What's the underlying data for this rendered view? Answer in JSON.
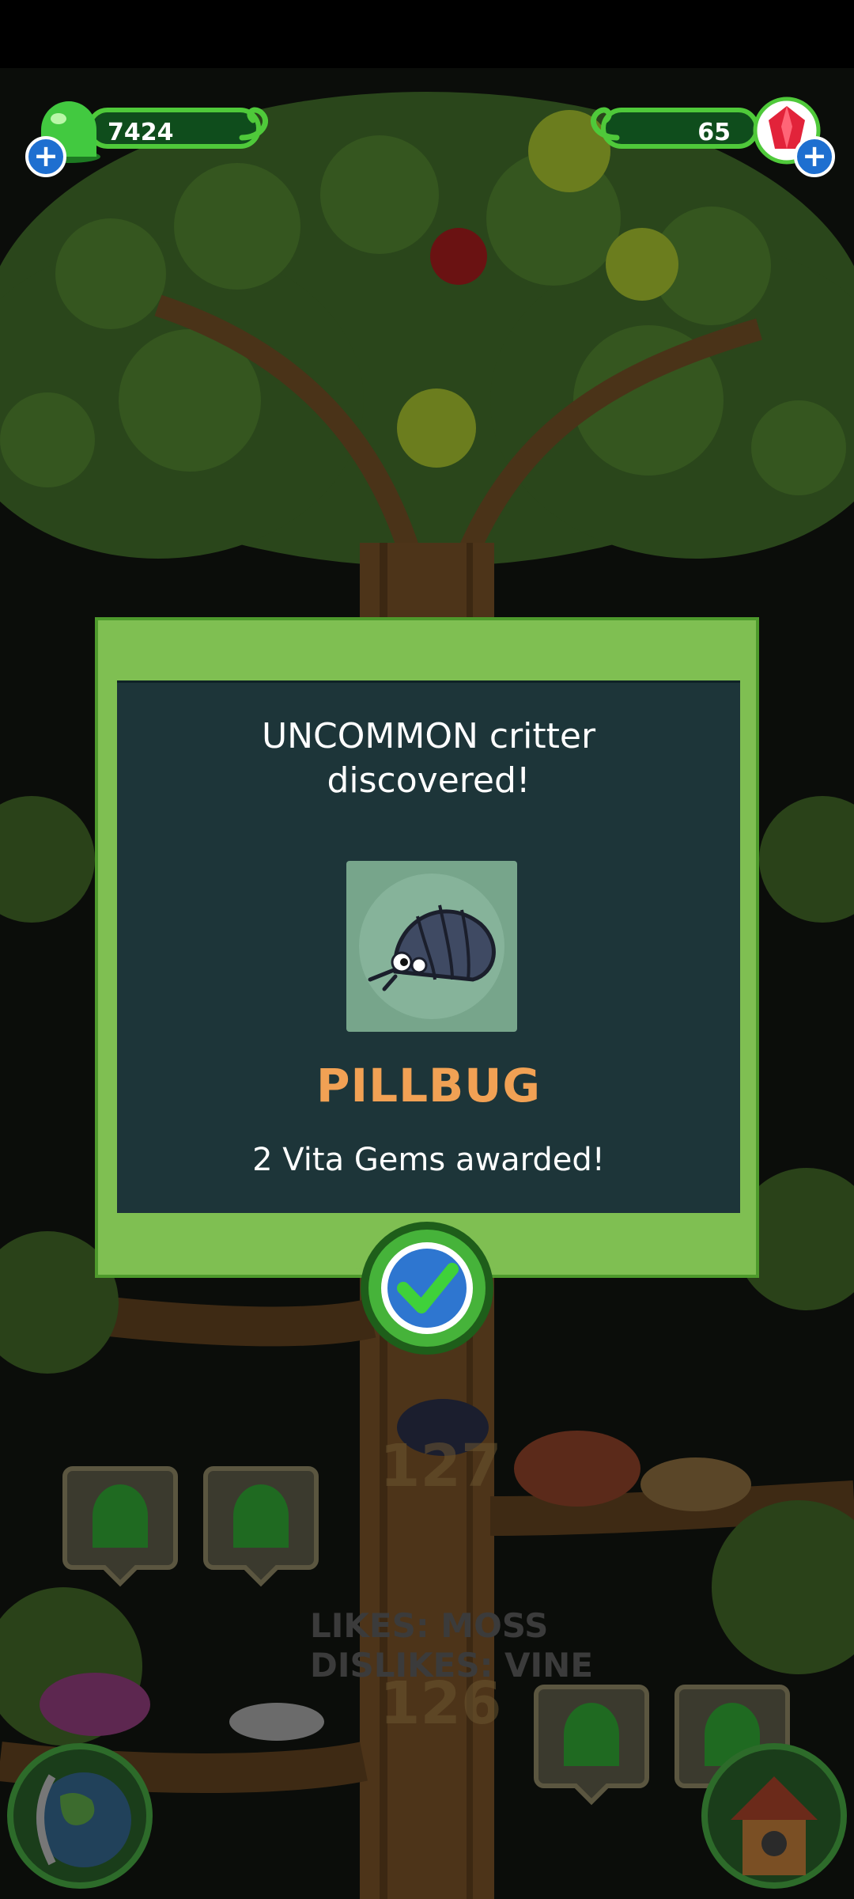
{
  "hud": {
    "gumdrops": "7424",
    "vita_gems": "65"
  },
  "modal": {
    "title_line1": "UNCOMMON critter",
    "title_line2": "discovered!",
    "critter_name": "PILLBUG",
    "award_text": "2 Vita Gems awarded!"
  },
  "tree": {
    "level_upper": "127",
    "level_lower": "126",
    "likes": "LIKES: MOSS",
    "dislikes": "DISLIKES: VINE"
  },
  "icons": {
    "gumdrop": "green-gumdrop-icon",
    "gem": "red-gem-icon",
    "plus": "plus-icon",
    "confirm": "checkmark-icon",
    "globe": "globe-icon",
    "house": "house-icon"
  },
  "colors": {
    "modal_frame": "#7fbf52",
    "modal_panel": "#1d3539",
    "critter_name": "#f1a154",
    "hud_border": "#4fc93a"
  }
}
